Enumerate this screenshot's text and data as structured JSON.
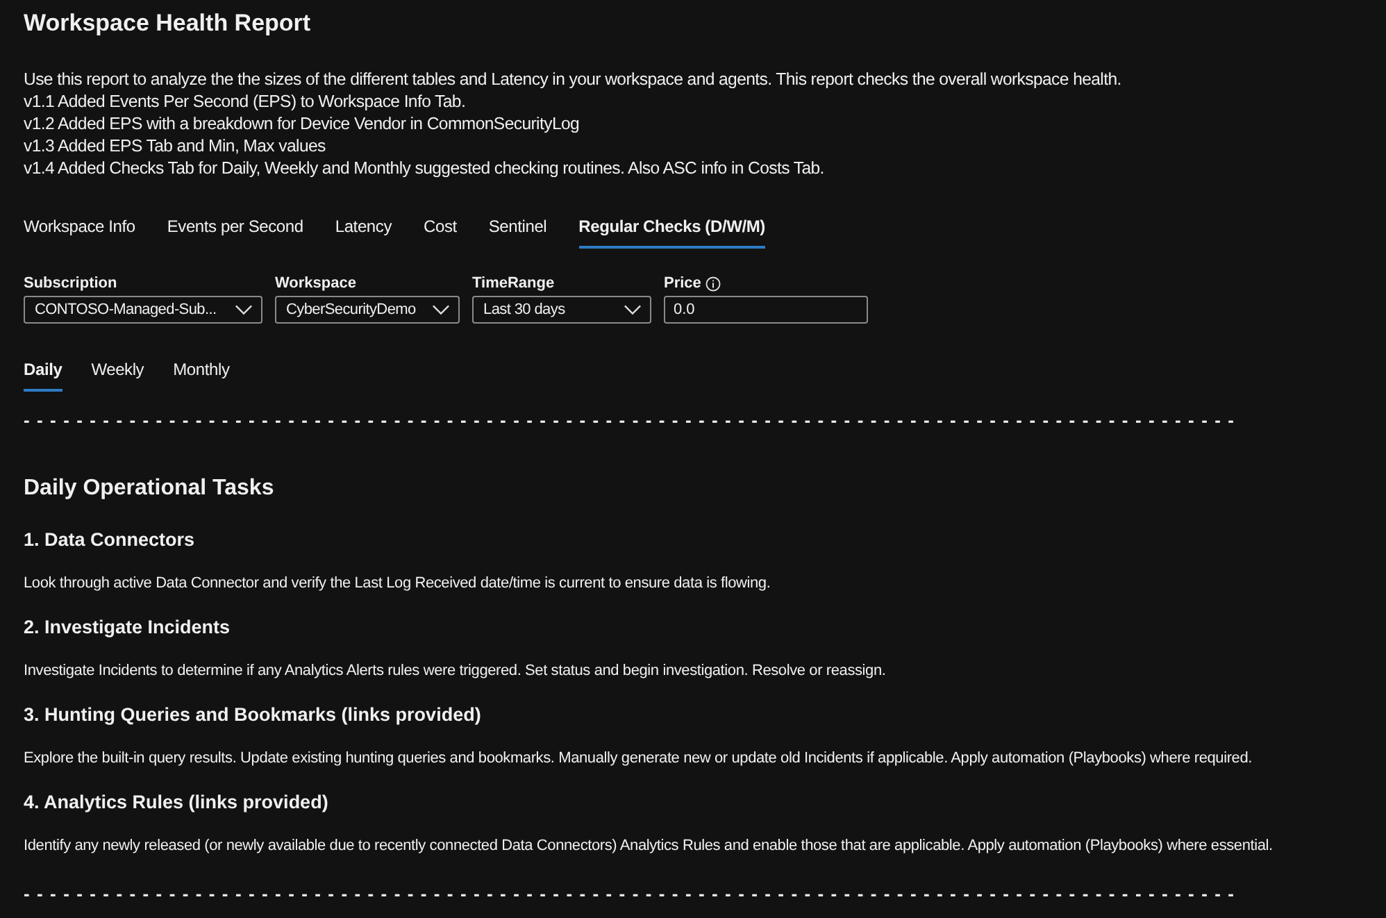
{
  "title": "Workspace Health Report",
  "description": [
    "Use this report to analyze the the sizes of the different tables and Latency in your workspace and agents. This report checks the overall workspace health.",
    "v1.1 Added Events Per Second (EPS) to Workspace Info Tab.",
    "v1.2 Added EPS with a breakdown for Device Vendor in CommonSecurityLog",
    "v1.3 Added EPS Tab and Min, Max values",
    "v1.4 Added Checks Tab for Daily, Weekly and Monthly suggested checking routines. Also ASC info in Costs Tab."
  ],
  "tabs": [
    {
      "label": "Workspace Info",
      "selected": false
    },
    {
      "label": "Events per Second",
      "selected": false
    },
    {
      "label": "Latency",
      "selected": false
    },
    {
      "label": "Cost",
      "selected": false
    },
    {
      "label": "Sentinel",
      "selected": false
    },
    {
      "label": "Regular Checks (D/W/M)",
      "selected": true
    }
  ],
  "parameters": [
    {
      "kind": "dropdown",
      "label": "Subscription",
      "value": "CONTOSO-Managed-Sub..."
    },
    {
      "kind": "dropdown",
      "label": "Workspace",
      "value": "CyberSecurityDemo"
    },
    {
      "kind": "dropdown",
      "label": "TimeRange",
      "value": "Last 30 days"
    },
    {
      "kind": "text",
      "label": "Price",
      "info": true,
      "value": "0.0"
    }
  ],
  "subtabs": [
    {
      "label": "Daily",
      "selected": true
    },
    {
      "label": "Weekly",
      "selected": false
    },
    {
      "label": "Monthly",
      "selected": false
    }
  ],
  "divider_top": "--------------------------------------------------------------------------------------------",
  "section_title": "Daily Operational Tasks",
  "tasks": [
    {
      "heading": "1. Data Connectors",
      "text": "Look through active Data Connector and verify the Last Log Received date/time is current to ensure data is flowing."
    },
    {
      "heading": "2. Investigate Incidents",
      "text": "Investigate Incidents to determine if any Analytics Alerts rules were triggered. Set status and begin investigation. Resolve or reassign."
    },
    {
      "heading": "3. Hunting Queries and Bookmarks (links provided)",
      "text": "Explore the built-in query results. Update existing hunting queries and bookmarks. Manually generate new or update old Incidents if applicable. Apply automation (Playbooks) where required."
    },
    {
      "heading": "4. Analytics Rules (links provided)",
      "text": "Identify any newly released (or newly available due to recently connected Data Connectors) Analytics Rules and enable those that are applicable. Apply automation (Playbooks) where essential."
    }
  ],
  "divider_bottom": "--------------------------------------------------------------------------------------------"
}
